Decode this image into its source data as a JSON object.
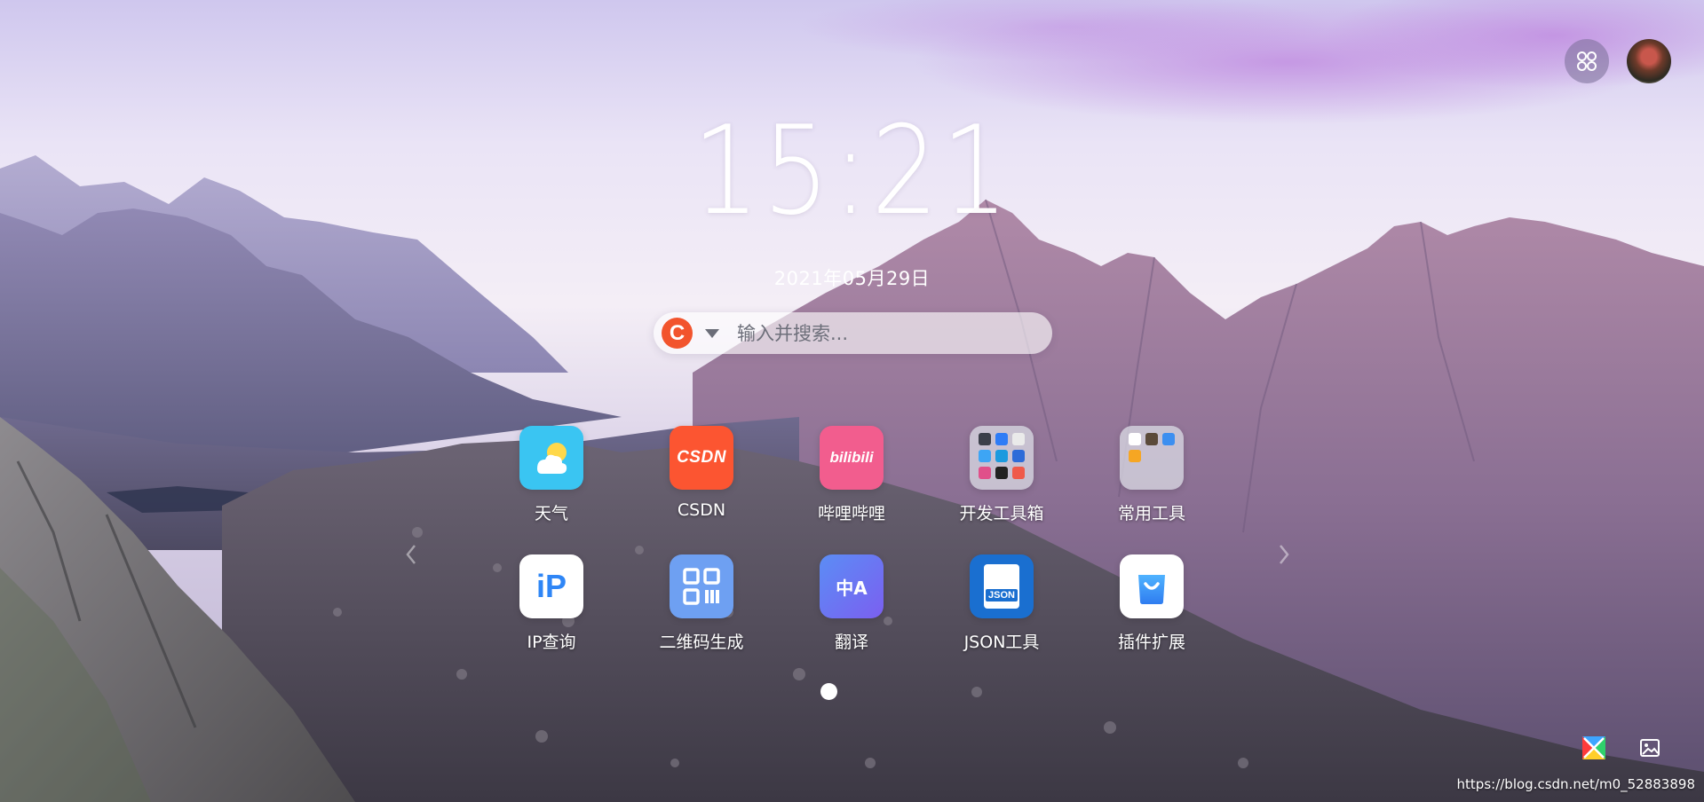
{
  "clock": {
    "time": "15:21",
    "date": "2021年05月29日"
  },
  "search": {
    "engine_letter": "C",
    "placeholder": "输入并搜索..."
  },
  "apps": [
    {
      "label": "天气",
      "icon": "weather-icon"
    },
    {
      "label": "CSDN",
      "icon": "csdn-icon",
      "icon_text": "CSDN"
    },
    {
      "label": "哔哩哔哩",
      "icon": "bilibili-icon",
      "icon_text": "bilibili"
    },
    {
      "label": "开发工具箱",
      "icon": "folder-icon"
    },
    {
      "label": "常用工具",
      "icon": "folder-icon"
    },
    {
      "label": "IP查询",
      "icon": "ip-lookup-icon",
      "icon_text": "iP"
    },
    {
      "label": "二维码生成",
      "icon": "qrcode-icon"
    },
    {
      "label": "翻译",
      "icon": "translate-icon",
      "icon_text": "中A"
    },
    {
      "label": "JSON工具",
      "icon": "json-file-icon",
      "icon_text": "JSON"
    },
    {
      "label": "插件扩展",
      "icon": "shopping-bag-icon"
    }
  ],
  "pager": {
    "current_page": 1,
    "page_count": 1
  },
  "watermark": "https://blog.csdn.net/m0_52883898",
  "colors": {
    "csdn": "#fc5531",
    "bilibili": "#f25d8e",
    "weather": "#3ac5f2",
    "qrcode": "#6ea0f2",
    "translate": "#6a74f0",
    "json": "#1a6fd0",
    "plugin": "#3f93f5"
  }
}
